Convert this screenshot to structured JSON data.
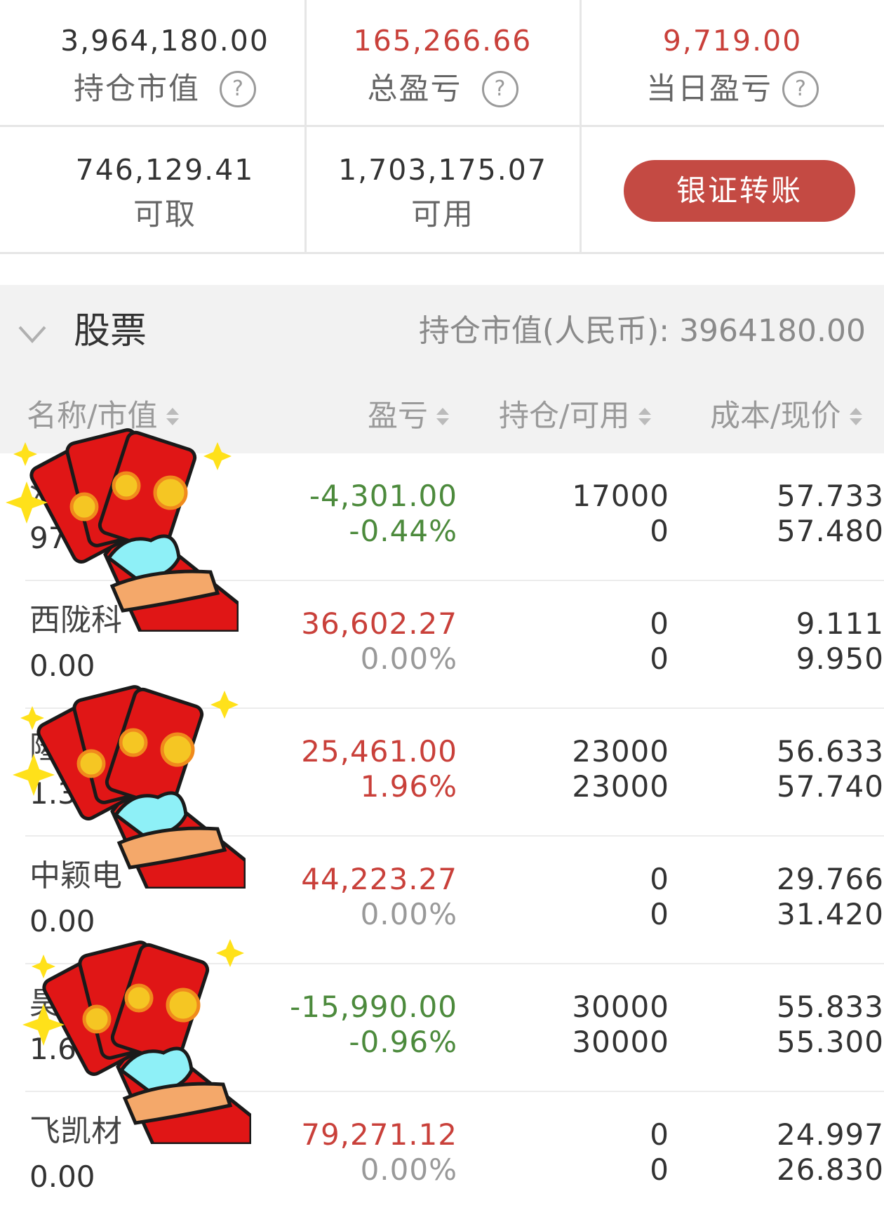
{
  "summary": {
    "market_value": {
      "value": "3,964,180.00",
      "label": "持仓市值"
    },
    "total_pl": {
      "value": "165,266.66",
      "label": "总盈亏"
    },
    "daily_pl": {
      "value": "9,719.00",
      "label": "当日盈亏"
    },
    "withdrawable": {
      "value": "746,129.41",
      "label": "可取"
    },
    "available": {
      "value": "1,703,175.07",
      "label": "可用"
    },
    "transfer_button": "银证转账",
    "help_glyph": "?"
  },
  "section": {
    "title": "股票",
    "total_label": "持仓市值(人民币):",
    "total_value": "3964180.00"
  },
  "columns": {
    "name": "名称/市值",
    "pl": "盈亏",
    "position": "持仓/可用",
    "cost": "成本/现价"
  },
  "rows": [
    {
      "name": "沃",
      "market_value": "97",
      "pl": "-4,301.00",
      "pl_pct": "-0.44%",
      "hold": "17000",
      "avail": "0",
      "cost": "57.733",
      "price": "57.480",
      "tone": "neg"
    },
    {
      "name": "西陇科",
      "market_value": "0.00",
      "pl": "36,602.27",
      "pl_pct": "0.00%",
      "hold": "0",
      "avail": "0",
      "cost": "9.111",
      "price": "9.950",
      "tone": "pos"
    },
    {
      "name": "隆",
      "market_value": "1.3",
      "pl": "25,461.00",
      "pl_pct": "1.96%",
      "hold": "23000",
      "avail": "23000",
      "cost": "56.633",
      "price": "57.740",
      "tone": "pos"
    },
    {
      "name": "中颖电",
      "market_value": "0.00",
      "pl": "44,223.27",
      "pl_pct": "0.00%",
      "hold": "0",
      "avail": "0",
      "cost": "29.766",
      "price": "31.420",
      "tone": "pos"
    },
    {
      "name": "昊",
      "market_value": "1.65",
      "pl": "-15,990.00",
      "pl_pct": "-0.96%",
      "hold": "30000",
      "avail": "30000",
      "cost": "55.833",
      "price": "55.300",
      "tone": "neg"
    },
    {
      "name": "飞凯材",
      "market_value": "0.00",
      "pl": "79,271.12",
      "pl_pct": "0.00%",
      "hold": "0",
      "avail": "0",
      "cost": "24.997",
      "price": "26.830",
      "tone": "pos"
    }
  ],
  "colors": {
    "positive": "#c9403a",
    "negative": "#4c8a3c",
    "button": "#c44a43"
  }
}
